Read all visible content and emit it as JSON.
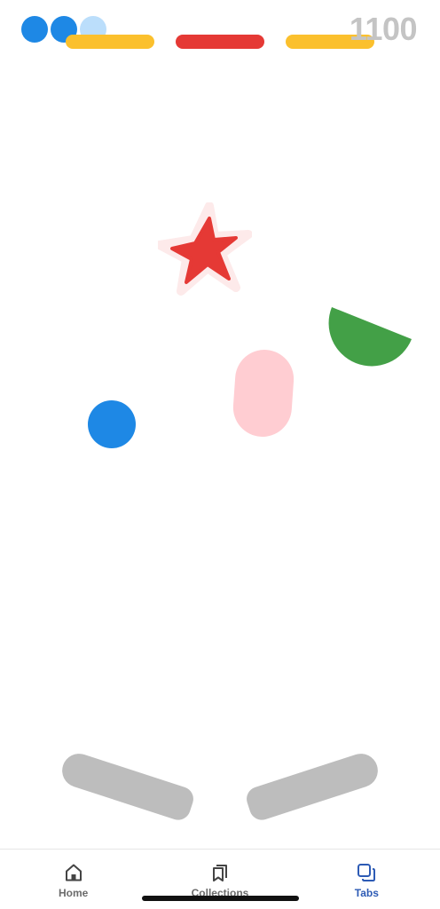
{
  "hud": {
    "lives": [
      {
        "state": "full",
        "color": "#1e88e5"
      },
      {
        "state": "full",
        "color": "#1e88e5"
      },
      {
        "state": "faded",
        "color": "#bbdefb"
      }
    ],
    "score": "1100",
    "score_color": "#c4c4c4"
  },
  "top_bumpers": [
    {
      "color": "#fbc02d"
    },
    {
      "color": "#e53935"
    },
    {
      "color": "#fbc02d"
    }
  ],
  "obstacles": {
    "star": {
      "color": "#e53935",
      "glow": "#fdeaea"
    },
    "half_disc": {
      "color": "#43a047"
    },
    "pill": {
      "color": "#ffcdd2"
    }
  },
  "ball": {
    "color": "#1e88e5"
  },
  "flippers": {
    "color": "#bdbdbd"
  },
  "tab_bar": {
    "items": [
      {
        "label": "Home",
        "icon": "home-icon",
        "active": false
      },
      {
        "label": "Collections",
        "icon": "collections-icon",
        "active": false
      },
      {
        "label": "Tabs",
        "icon": "tabs-icon",
        "active": true
      }
    ],
    "active_color": "#2d5bb5",
    "inactive_color": "#6b6b6b"
  }
}
